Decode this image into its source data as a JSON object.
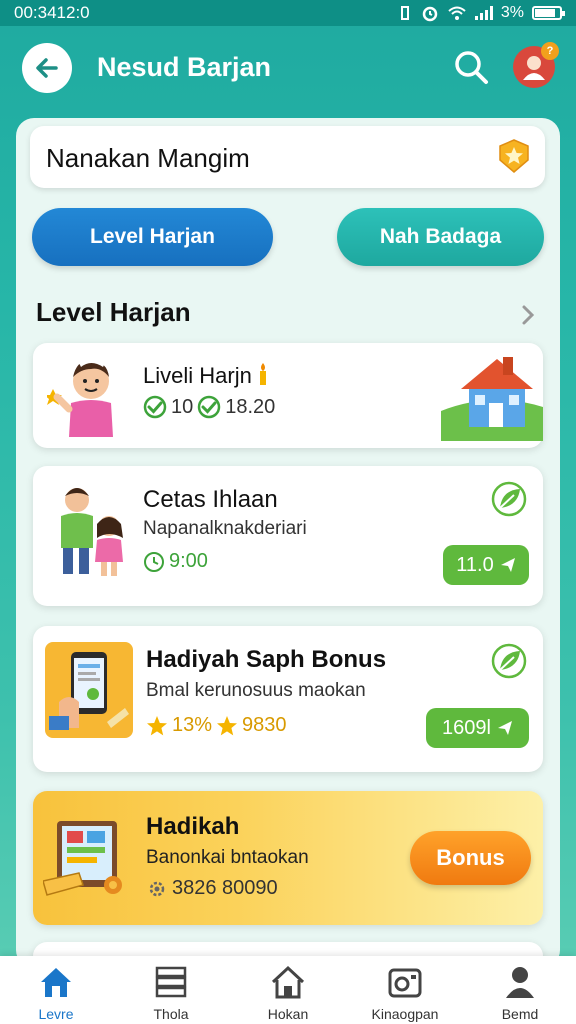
{
  "status_bar": {
    "time": "00:3412:0",
    "battery": "3%"
  },
  "header": {
    "title": "Nesud Barjan"
  },
  "search_card": {
    "text": "Nanakan Mangim"
  },
  "tabs": {
    "left": "Level Harjan",
    "right": "Nah Badaga"
  },
  "section": {
    "title": "Level Harjan"
  },
  "cards": [
    {
      "title": "Liveli Harjn",
      "meta_a": "10",
      "meta_b": "18.20"
    },
    {
      "title": "Cetas Ihlaan",
      "subtitle": "Napanalknakderiari",
      "meta": "9:00",
      "button": "11.0"
    },
    {
      "title": "Hadiyah Saph Bonus",
      "subtitle": "Bmal kerunosuus maokan",
      "meta_a": "13%",
      "meta_b": "9830",
      "button": "1609l"
    },
    {
      "title": "Hadikah",
      "subtitle": "Banonkai bntaokan",
      "meta": "3826 80090",
      "button": "Bonus"
    }
  ],
  "bottom_nav": [
    {
      "label": "Levre",
      "icon": "home-icon"
    },
    {
      "label": "Thola",
      "icon": "stack-icon"
    },
    {
      "label": "Hokan",
      "icon": "house-outline-icon"
    },
    {
      "label": "Kinaogpan",
      "icon": "camera-icon"
    },
    {
      "label": "Bemd",
      "icon": "person-icon"
    }
  ],
  "colors": {
    "accent_blue": "#1a76c9",
    "teal": "#1faaa0",
    "green": "#5fb93d",
    "orange": "#f07a10"
  }
}
